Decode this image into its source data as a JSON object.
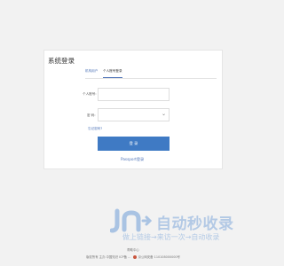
{
  "login": {
    "title": "系统登录",
    "tabs": [
      "机构用户",
      "个人账号登录"
    ],
    "account_label": "个人账号:",
    "password_label": "密  码:",
    "forgot_label": "忘记密码?",
    "login_button": "登 录",
    "passport_link": "Passport登录"
  },
  "watermark": {
    "title": "自动秒收录",
    "slogan": "做上链接→来访一次→自动收录"
  },
  "footer": {
    "line1": "帮助中心",
    "line2": "版权所有 主办 中国知识 ICP备 …",
    "line3": "京公网安备 110108000000号"
  },
  "colors": {
    "accent": "#3f7ac4",
    "link": "#4f74b8",
    "background": "#f2f2f2",
    "watermark": "#a9c3e3"
  }
}
